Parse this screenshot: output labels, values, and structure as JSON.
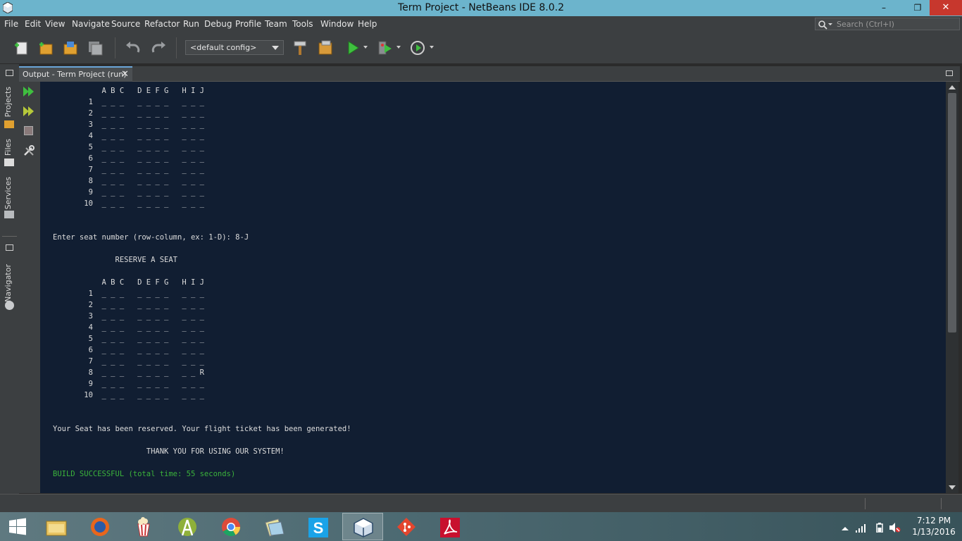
{
  "window": {
    "title": "Term Project - NetBeans IDE 8.0.2",
    "minimize": "–",
    "restore": "❐",
    "close": "✕"
  },
  "menu": [
    "File",
    "Edit",
    "View",
    "Navigate",
    "Source",
    "Refactor",
    "Run",
    "Debug",
    "Profile",
    "Team",
    "Tools",
    "Window",
    "Help"
  ],
  "search": {
    "placeholder": "Search (Ctrl+I)"
  },
  "toolbar": {
    "config": "<default config>"
  },
  "sidebar": {
    "projects": "Projects",
    "files": "Files",
    "services": "Services",
    "navigator": "Navigator"
  },
  "output_tab": {
    "label": "Output - Term Project (run)",
    "close": "✕"
  },
  "console": {
    "lines": [
      "           A B C   D E F G   H I J",
      "        1  _ _ _   _ _ _ _   _ _ _",
      "        2  _ _ _   _ _ _ _   _ _ _",
      "        3  _ _ _   _ _ _ _   _ _ _",
      "        4  _ _ _   _ _ _ _   _ _ _",
      "        5  _ _ _   _ _ _ _   _ _ _",
      "        6  _ _ _   _ _ _ _   _ _ _",
      "        7  _ _ _   _ _ _ _   _ _ _",
      "        8  _ _ _   _ _ _ _   _ _ _",
      "        9  _ _ _   _ _ _ _   _ _ _",
      "       10  _ _ _   _ _ _ _   _ _ _",
      "",
      "",
      "Enter seat number (row-column, ex: 1-D): 8-J",
      "",
      "              RESERVE A SEAT",
      "",
      "           A B C   D E F G   H I J",
      "        1  _ _ _   _ _ _ _   _ _ _",
      "        2  _ _ _   _ _ _ _   _ _ _",
      "        3  _ _ _   _ _ _ _   _ _ _",
      "        4  _ _ _   _ _ _ _   _ _ _",
      "        5  _ _ _   _ _ _ _   _ _ _",
      "        6  _ _ _   _ _ _ _   _ _ _",
      "        7  _ _ _   _ _ _ _   _ _ _",
      "        8  _ _ _   _ _ _ _   _ _ R",
      "        9  _ _ _   _ _ _ _   _ _ _",
      "       10  _ _ _   _ _ _ _   _ _ _",
      "",
      "",
      "Your Seat has been reserved. Your flight ticket has been generated!",
      "",
      "                     THANK YOU FOR USING OUR SYSTEM!",
      ""
    ],
    "build": "BUILD SUCCESSFUL (total time: 55 seconds)"
  },
  "clock": {
    "time": "7:12 PM",
    "date": "1/13/2016"
  },
  "colors": {
    "titlebar": "#6cb4cc",
    "console_bg": "#111e32",
    "build_green": "#3bb33b",
    "close_red": "#c7372d"
  }
}
